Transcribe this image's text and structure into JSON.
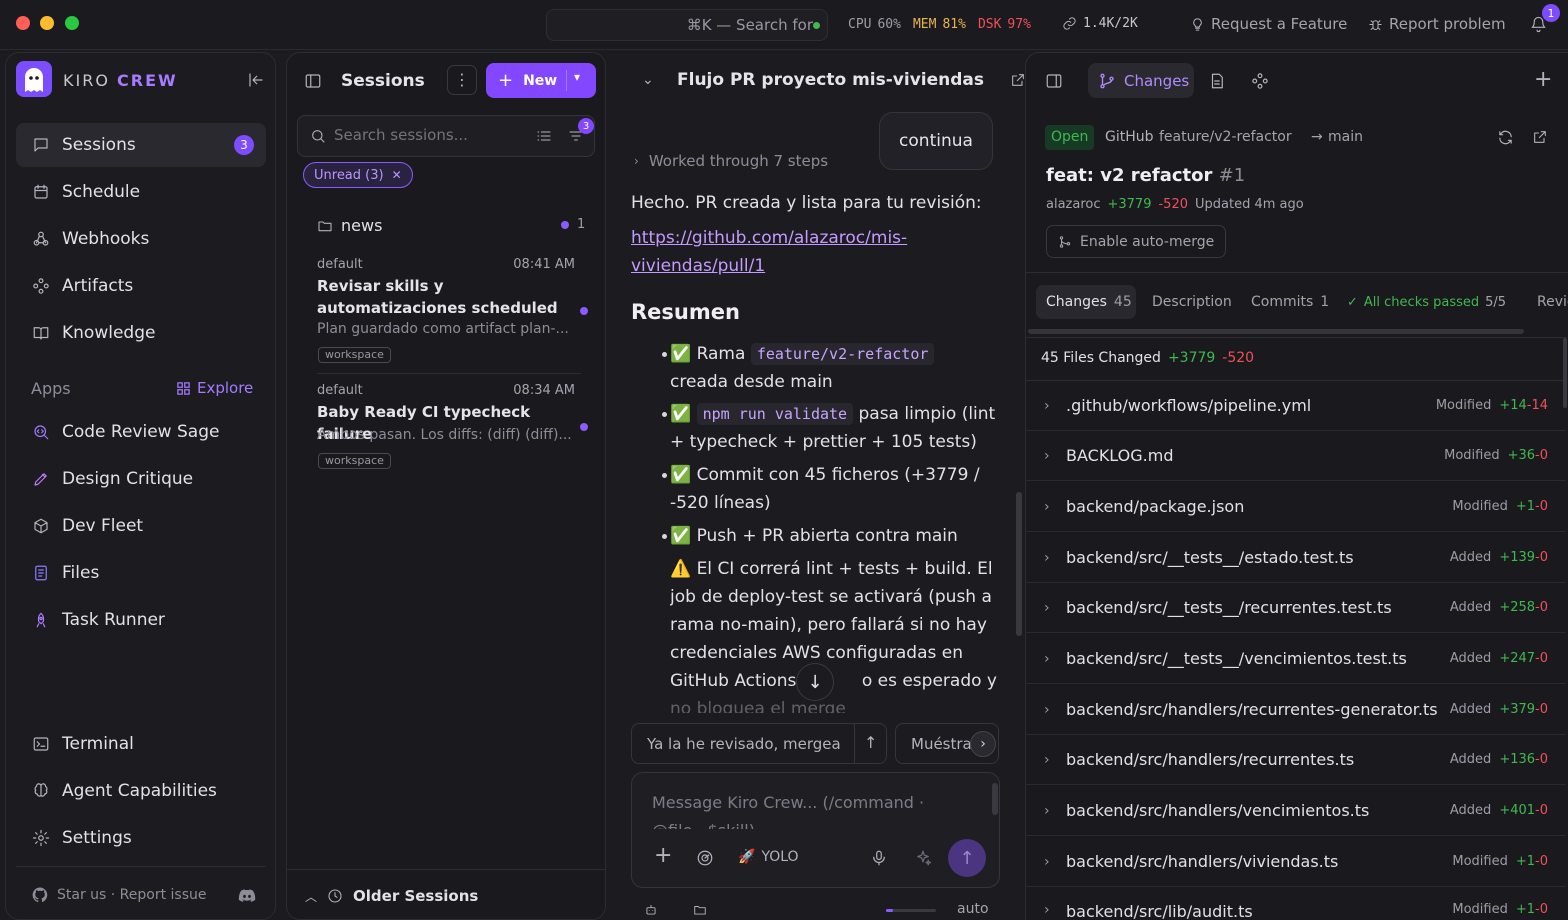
{
  "topbar": {
    "search": "⌘K — Search for",
    "cpu_label": "CPU",
    "cpu_val": "60%",
    "mem_label": "MEM",
    "mem_val": "81%",
    "dsk_label": "DSK",
    "dsk_val": "97%",
    "tokens": "1.4K/2K",
    "request": "Request a Feature",
    "report": "Report problem",
    "notif_count": "1"
  },
  "sidebar": {
    "brand_a": "KIRO",
    "brand_b": "CREW",
    "items": [
      {
        "label": "Sessions",
        "badge": "3"
      },
      {
        "label": "Schedule"
      },
      {
        "label": "Webhooks"
      },
      {
        "label": "Artifacts"
      },
      {
        "label": "Knowledge"
      }
    ],
    "apps_label": "Apps",
    "explore": "Explore",
    "apps": [
      "Code Review Sage",
      "Design Critique",
      "Dev Fleet",
      "Files",
      "Task Runner"
    ],
    "bottom": [
      "Terminal",
      "Agent Capabilities",
      "Settings"
    ],
    "footer": "Star us · Report issue"
  },
  "sessions": {
    "title": "Sessions",
    "new_label": "New",
    "search_placeholder": "Search sessions...",
    "filter_count": "3",
    "chip": "Unread (3)",
    "folder": "news",
    "folder_count": "1",
    "list": [
      {
        "group": "default",
        "time": "08:41 AM",
        "title": "Revisar skills y automatizaciones scheduled",
        "preview": "Plan guardado como artifact plan-...",
        "tag": "workspace"
      },
      {
        "group": "default",
        "time": "08:34 AM",
        "title": "Baby Ready CI typecheck failure",
        "preview": "Ambos pasan. Los diffs: (diff) (diff)...",
        "tag": "workspace"
      }
    ],
    "older": "Older Sessions"
  },
  "chat": {
    "title": "Flujo PR proyecto mis-viviendas",
    "user_msg": "continua",
    "steps": "Worked through 7 steps",
    "intro": "Hecho. PR creada y lista para tu revisión:",
    "link_line1": "https://github.com/alazaroc/mis-",
    "link_line2": "viviendas/pull/1",
    "heading": "Resumen",
    "b1_a": "✅ Rama",
    "b1_code": "feature/v2-refactor",
    "b1_b": "creada desde main",
    "b2_code": "npm run validate",
    "b2_a": "pasa limpio (lint",
    "b2_b": "+ typecheck + prettier + 105 tests)",
    "b3_a": "✅ Commit con 45 ficheros (+3779 /",
    "b3_b": "-520 líneas)",
    "b4": "✅ Push + PR abierta contra main",
    "b5_1": "⚠️ El CI correrá lint + tests + build. El",
    "b5_2": "job de deploy-test se activará (push a",
    "b5_3": "rama no-main), pero fallará si no hay",
    "b5_4": "credenciales AWS configuradas en",
    "b5_5a": "GitHub Actions",
    "b5_5b": "o es esperado y",
    "b5_6": "no bloquea el merge",
    "suggest1": "Ya la he revisado, mergea",
    "suggest2": "Muéstra",
    "input_placeholder": "Message Kiro Crew... (/command · @file · $skill)",
    "yolo": "YOLO",
    "auto": "auto"
  },
  "pr": {
    "changes_tab": "Changes",
    "status": "Open",
    "source": "GitHub",
    "branch": "feature/v2-refactor",
    "target": "main",
    "title": "feat: v2 refactor",
    "number": "#1",
    "author": "alazaroc",
    "adds": "+3779",
    "dels": "-520",
    "updated": "Updated 4m ago",
    "automerge": "Enable auto-merge",
    "tabs": {
      "changes": "Changes",
      "changes_count": "45",
      "description": "Description",
      "commits": "Commits",
      "commits_count": "1",
      "checks": "All checks passed",
      "checks_count": "5/5",
      "review": "Revie"
    },
    "files_header": "45 Files Changed",
    "files": [
      {
        "name": ".github/workflows/pipeline.yml",
        "status": "Modified",
        "add": "+14",
        "del": "-14"
      },
      {
        "name": "BACKLOG.md",
        "status": "Modified",
        "add": "+36",
        "del": "-0"
      },
      {
        "name": "backend/package.json",
        "status": "Modified",
        "add": "+1",
        "del": "-0"
      },
      {
        "name": "backend/src/__tests__/estado.test.ts",
        "status": "Added",
        "add": "+139",
        "del": "-0"
      },
      {
        "name": "backend/src/__tests__/recurrentes.test.ts",
        "status": "Added",
        "add": "+258",
        "del": "-0"
      },
      {
        "name": "backend/src/__tests__/vencimientos.test.ts",
        "status": "Added",
        "add": "+247",
        "del": "-0"
      },
      {
        "name": "backend/src/handlers/recurrentes-generator.ts",
        "status": "Added",
        "add": "+379",
        "del": "-0"
      },
      {
        "name": "backend/src/handlers/recurrentes.ts",
        "status": "Added",
        "add": "+136",
        "del": "-0"
      },
      {
        "name": "backend/src/handlers/vencimientos.ts",
        "status": "Added",
        "add": "+401",
        "del": "-0"
      },
      {
        "name": "backend/src/handlers/viviendas.ts",
        "status": "Modified",
        "add": "+1",
        "del": "-0"
      },
      {
        "name": "backend/src/lib/audit.ts",
        "status": "Modified",
        "add": "+1",
        "del": "-0"
      }
    ]
  }
}
